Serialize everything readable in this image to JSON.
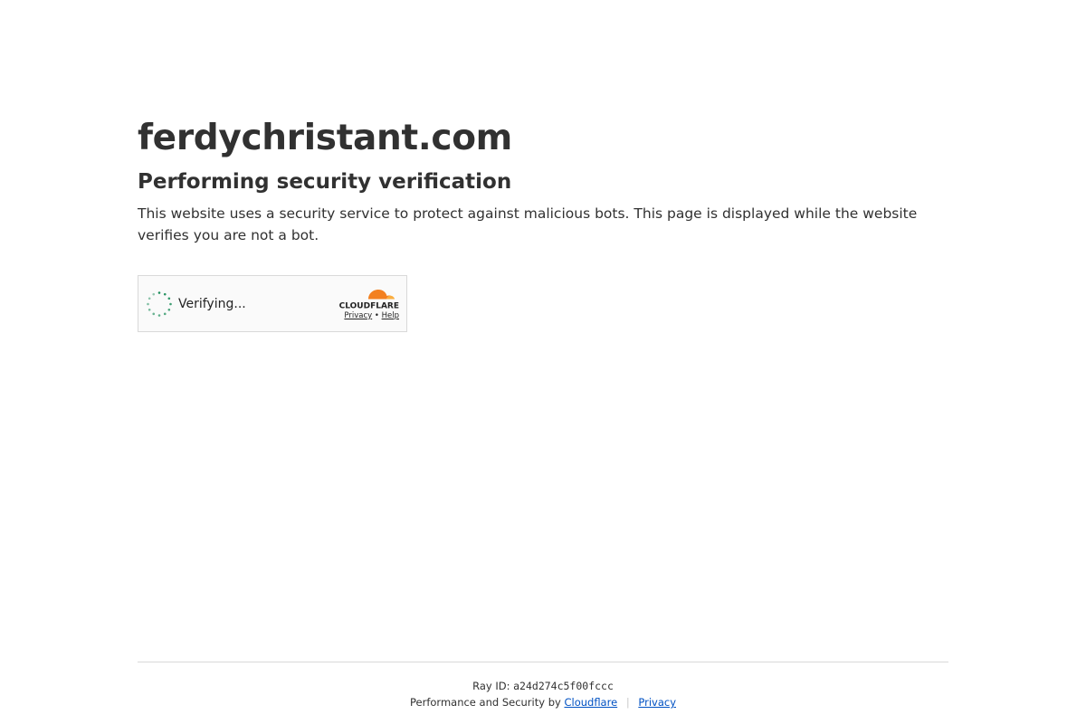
{
  "header": {
    "site_title": "ferdychristant.com",
    "subtitle": "Performing security verification",
    "description": "This website uses a security service to protect against malicious bots. This page is displayed while the website verifies you are not a bot."
  },
  "widget": {
    "status_text": "Verifying...",
    "brand_text": "CLOUDFLARE",
    "privacy_label": "Privacy",
    "link_separator": "•",
    "help_label": "Help",
    "spinner_icon": "loading-spinner-icon",
    "logo_icon": "cloudflare-cloud-icon",
    "accent_color": "#f38020",
    "spinner_color": "#1d8e5b"
  },
  "footer": {
    "ray_label": "Ray ID:",
    "ray_id": "a24d274c5f00fccc",
    "performance_text": "Performance and Security by",
    "cloudflare_link": "Cloudflare",
    "separator": "|",
    "privacy_link": "Privacy",
    "link_color": "#0051c3"
  }
}
